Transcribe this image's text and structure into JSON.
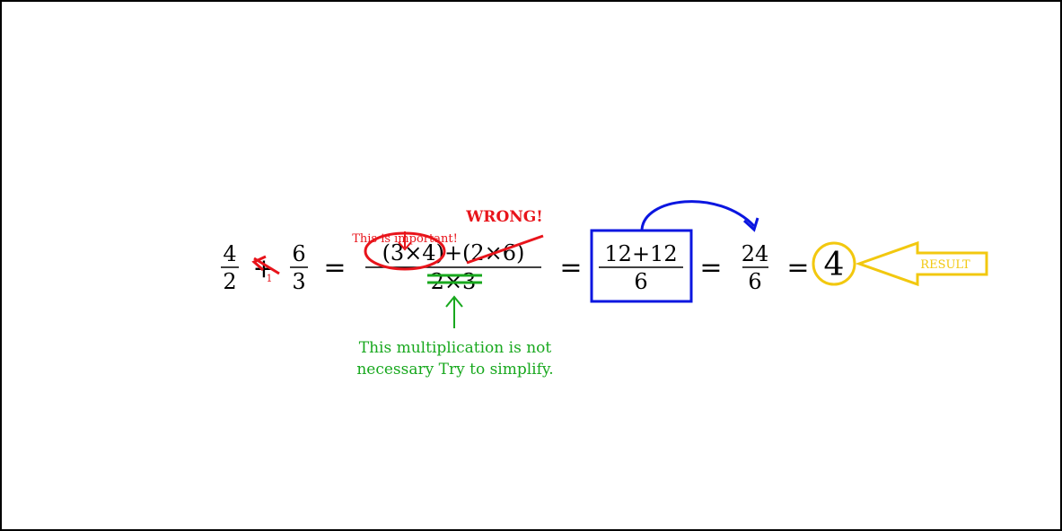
{
  "equation": {
    "frac1": {
      "num": "4",
      "den": "2"
    },
    "plus": "+",
    "frac2": {
      "num": "6",
      "den": "3"
    },
    "eq1": "=",
    "frac3": {
      "num": "(3×4)+(2×6)",
      "den": "2×3"
    },
    "eq2": "=",
    "frac4": {
      "num": "12+12",
      "den": "6"
    },
    "eq3": "=",
    "frac5": {
      "num": "24",
      "den": "6"
    },
    "eq4": "=",
    "result": "4"
  },
  "annotations": {
    "plus_note": "1",
    "important": "This is important!",
    "wrong": "WRONG!",
    "simplify": "This multiplication is not necessary Try to simplify.",
    "result_label": "RESULT"
  },
  "colors": {
    "red": "#e8141b",
    "green": "#18a81e",
    "blue": "#0b16e0",
    "yellow": "#f2c80f"
  }
}
